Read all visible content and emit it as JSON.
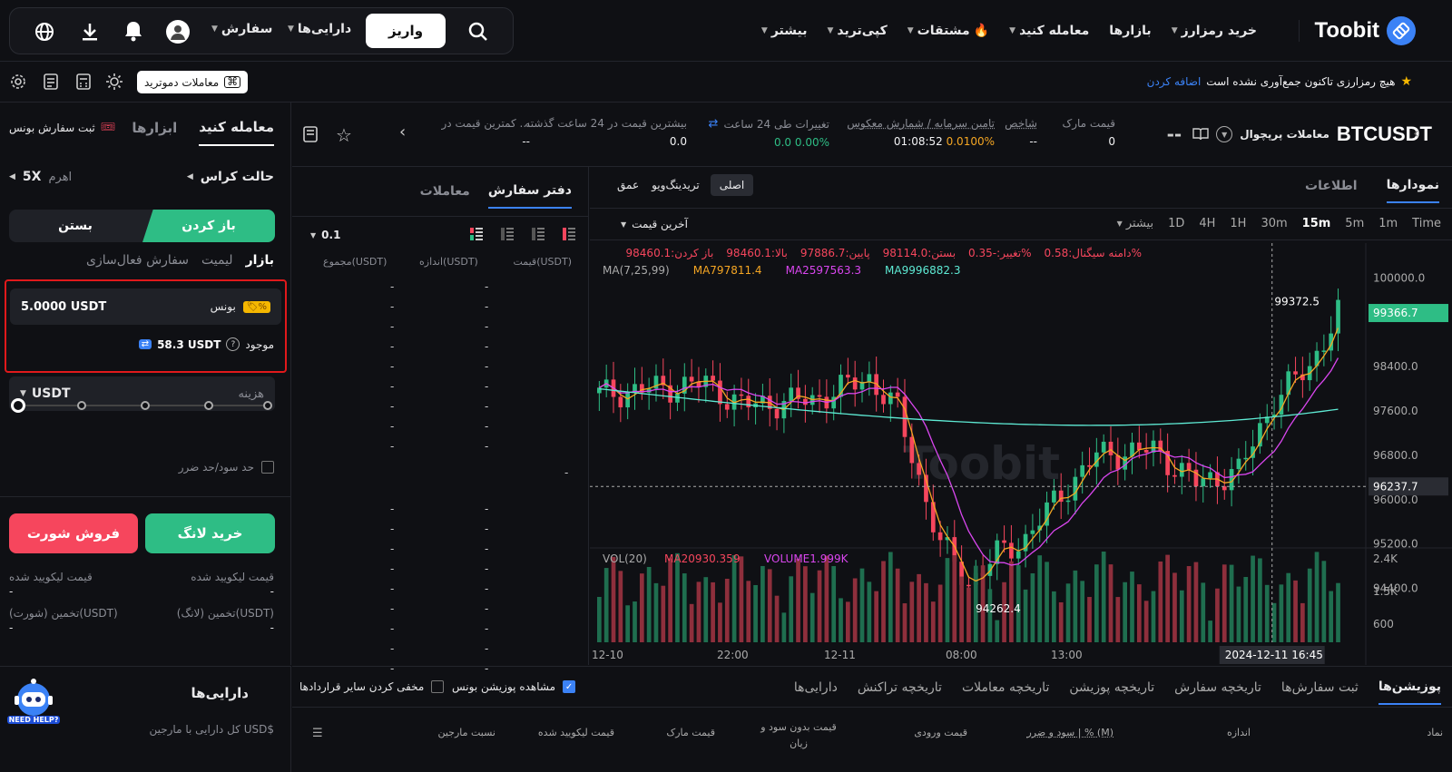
{
  "brand": {
    "name": "Toobit",
    "logo_color": "#3b82f6"
  },
  "colors": {
    "green": "#2ebd85",
    "red": "#f6465d",
    "accent": "#3b82f6",
    "bg": "#0f1014"
  },
  "nav": {
    "items": [
      "خرید رمزارز",
      "بازارها",
      "معامله کنید",
      "مشتقات",
      "کپی‌ترید",
      "بیشتر"
    ],
    "search_icon": "search-icon",
    "deposit": "واریز",
    "assets": "دارایی‌ها",
    "orders": "سفارش"
  },
  "subbar": {
    "announcement": "هیچ رمزارزی تاکنون جمع‌آوری نشده است",
    "add_link": "اضافه کردن",
    "demo_button": "معاملات دموترید"
  },
  "ticker": {
    "symbol": "BTCUSDT",
    "type": "معاملات پرپچوال",
    "price": "--",
    "stats": [
      {
        "label": "قیمت مارک",
        "value": "0"
      },
      {
        "label": "شاخص",
        "value": "--"
      },
      {
        "label": "تامین سرمایه / شمارش معکوس",
        "value_time": "01:08:52",
        "value_rate": "0.0100%"
      },
      {
        "label": "تغییرات طی 24 ساعت",
        "value": "0.0 0.00%"
      },
      {
        "label": "بیشترین قیمت در 24 ساعت گذشته",
        "value": "0.0"
      },
      {
        "label": "کمترین قیمت در ...",
        "value": "--"
      }
    ]
  },
  "chart_panel": {
    "tabs": [
      "نمودارها",
      "اطلاعات"
    ],
    "views": [
      "اصلی",
      "تریدینگ‌ویو",
      "عمق"
    ],
    "intervals": [
      "Time",
      "1m",
      "5m",
      "15m",
      "30m",
      "1H",
      "4H",
      "1D"
    ],
    "active_interval": "15m",
    "more": "بیشتر",
    "last_price": "آخرین قیمت",
    "ohlc": {
      "open": "باز کردن:98460.1",
      "high": "بالا:98460.1",
      "low": "پایین:97886.7",
      "close": "بستن:98114.0",
      "change": "تغییر:-0.35%",
      "amp": "دامنه سیگنال:0.58%"
    },
    "ma": {
      "label": "MA(7,25,99)",
      "ma7": "MA797811.4",
      "ma25": "MA2597563.3",
      "ma99": "MA9996882.3"
    },
    "vol": {
      "label": "VOL(20)",
      "ma": "MA20930.359",
      "volume": "VOLUME1.999K"
    },
    "price_axis": [
      "100000.0",
      "98400.0",
      "97600.0",
      "96800.0",
      "96000.0",
      "95200.0",
      "94400.0"
    ],
    "current_price": "99366.7",
    "cross_price": "96237.7",
    "high_mark": "99372.5",
    "low_mark": "94262.4",
    "vol_axis": [
      "2.4K",
      "1.5K",
      "600"
    ],
    "time_axis": [
      "12-10",
      "22:00",
      "12-11",
      "08:00",
      "13:00"
    ],
    "cross_time": "2024-12-11 16:45"
  },
  "chart_data": {
    "type": "candlestick",
    "x_range": [
      "2024-12-10",
      "2024-12-11 17:00"
    ],
    "ylim": [
      94000,
      100300
    ],
    "high_marker": 99372.5,
    "low_marker": 94262.4,
    "last": 99366.7,
    "series": [
      {
        "name": "MA7"
      },
      {
        "name": "MA25"
      },
      {
        "name": "MA99"
      }
    ]
  },
  "orderbook": {
    "tabs": [
      "دفتر سفارش",
      "معاملات"
    ],
    "precision": "0.1",
    "headers": [
      "قیمت(USDT)",
      "اندازه(USDT)",
      "مجموع(USDT)"
    ]
  },
  "trade": {
    "tabs": [
      "معامله کنید",
      "ابزارها"
    ],
    "bonus_order": "ثبت سفارش بونس",
    "margin_mode": "حالت کراس",
    "leverage_label": "اهرم",
    "leverage": "5X",
    "open": "باز کردن",
    "close": "بستن",
    "order_types": [
      "بازار",
      "لیمیت",
      "سفارش فعال‌سازی"
    ],
    "bonus_label": "بونس",
    "bonus_value": "5.0000 USDT",
    "available_label": "موجود",
    "available_value": "58.3 USDT",
    "cost_label": "هزینه",
    "cost_unit": "USDT",
    "tpsl": "حد سود/حد ضرر",
    "buy": "خرید لانگ",
    "sell": "فروش شورت",
    "liq_long": "قیمت لیکویید شده",
    "liq_short": "قیمت لیکویید شده",
    "est_long": "تخمین (لانگ)(USDT)",
    "est_short": "تخمین (شورت)(USDT)",
    "dash": "-"
  },
  "assets_box": {
    "title": "دارایی‌ها",
    "subtitle": "کل دارایی با مارجین USD$",
    "help": "NEED HELP?"
  },
  "positions": {
    "tabs": [
      "پوزیشن‌ها",
      "ثبت سفارش‌ها",
      "تاریخچه سفارش",
      "تاریخچه پوزیشن",
      "تاریخچه معاملات",
      "تاریخچه تراکنش",
      "دارایی‌ها"
    ],
    "show_bonus": "مشاهده پوزیشن بونس",
    "hide_others": "مخفی کردن سایر قراردادها",
    "columns": [
      "نماد",
      "اندازه",
      "سود و ضرر | % (M)",
      "قیمت ورودی",
      "قیمت بدون سود و زیان",
      "قیمت مارک",
      "قیمت لیکویید شده",
      "نسبت مارجین"
    ]
  }
}
